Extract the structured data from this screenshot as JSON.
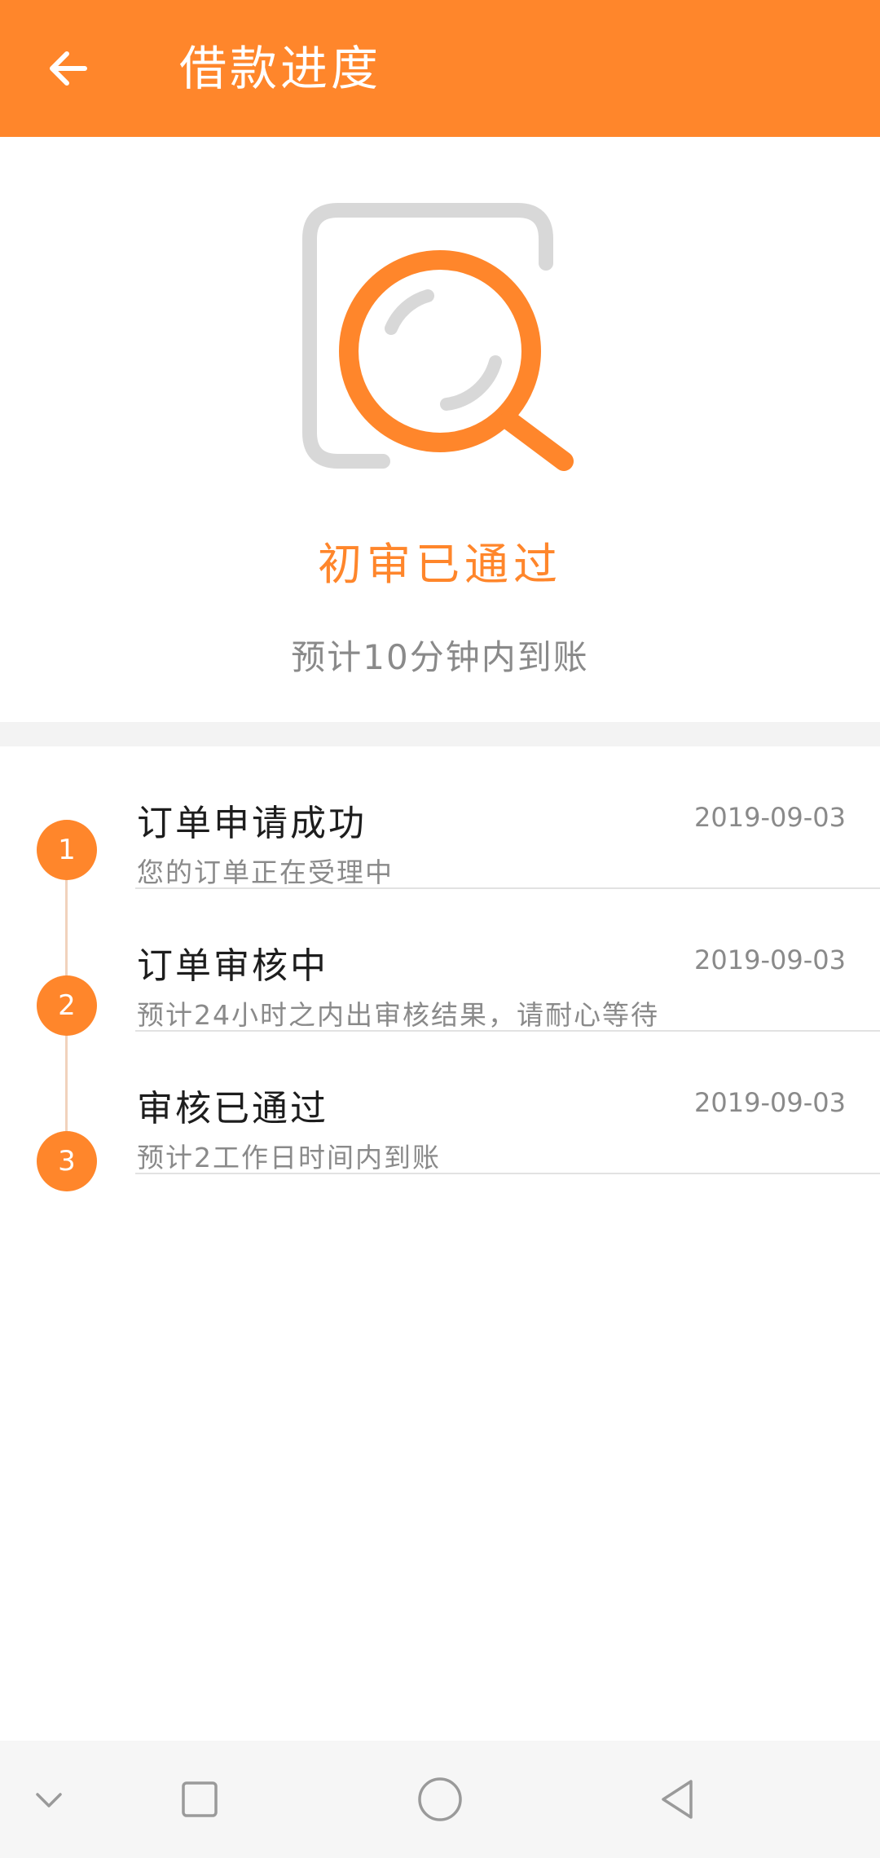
{
  "header": {
    "title": "借款进度",
    "back_icon": "arrow-left-icon"
  },
  "status": {
    "icon": "magnifier-search-icon",
    "title": "初审已通过",
    "subtitle": "预计10分钟内到账"
  },
  "timeline": {
    "steps": [
      {
        "number": "1",
        "title": "订单申请成功",
        "date": "2019-09-03",
        "description": "您的订单正在受理中"
      },
      {
        "number": "2",
        "title": "订单审核中",
        "date": "2019-09-03",
        "description": "预计24小时之内出审核结果，请耐心等待"
      },
      {
        "number": "3",
        "title": "审核已通过",
        "date": "2019-09-03",
        "description": "预计2工作日时间内到账"
      }
    ]
  },
  "navigation": {
    "buttons": [
      "chevron-down-icon",
      "square-recents-icon",
      "circle-home-icon",
      "triangle-back-icon"
    ]
  },
  "colors": {
    "accent": "#FF862B",
    "text_primary": "#1d1d1d",
    "text_secondary": "#8a8a8a",
    "divider": "#e2e2e2"
  }
}
